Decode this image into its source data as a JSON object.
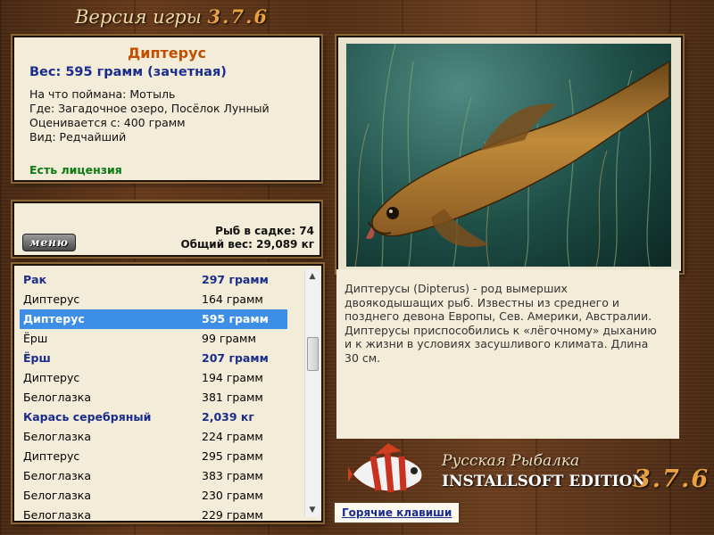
{
  "header": {
    "version_prefix": "Версия игры",
    "version_number": "3.7.6"
  },
  "info": {
    "fish_name": "Диптерус",
    "weight": "Вес: 595 грамм (зачетная)",
    "bait": "На что поймана: Мотыль",
    "place": "Где: Загадочное озеро, Посёлок Лунный",
    "rated": "Оценивается с: 400 грамм",
    "kind": "Вид: Редчайший",
    "license": "Есть лицензия"
  },
  "stats": {
    "menu_label": "меню",
    "fish_in_keepnet": "Рыб в садке: 74",
    "total_weight": "Общий вес: 29,089 кг"
  },
  "catch_list": [
    {
      "name": "Рак",
      "weight": "297 грамм",
      "style": "bold"
    },
    {
      "name": "Диптерус",
      "weight": "164 грамм",
      "style": "normal"
    },
    {
      "name": "Диптерус",
      "weight": "595 грамм",
      "style": "selected"
    },
    {
      "name": "Ёрш",
      "weight": "99 грамм",
      "style": "normal"
    },
    {
      "name": "Ёрш",
      "weight": "207 грамм",
      "style": "bold"
    },
    {
      "name": "Диптерус",
      "weight": "194 грамм",
      "style": "normal"
    },
    {
      "name": "Белоглазка",
      "weight": "381 грамм",
      "style": "normal"
    },
    {
      "name": "Карась серебряный",
      "weight": "2,039 кг",
      "style": "bold"
    },
    {
      "name": "Белоглазка",
      "weight": "224 грамм",
      "style": "normal"
    },
    {
      "name": "Диптерус",
      "weight": "295 грамм",
      "style": "normal"
    },
    {
      "name": "Белоглазка",
      "weight": "383 грамм",
      "style": "normal"
    },
    {
      "name": "Белоглазка",
      "weight": "230 грамм",
      "style": "normal"
    },
    {
      "name": "Белоглазка",
      "weight": "229 грамм",
      "style": "normal"
    }
  ],
  "description": "Диптерусы (Dipterus) - род вымерших двоякодышащих рыб. Известны из среднего и позднего девона Европы, Сев. Америки, Австралии. Диптерусы приспособились к «лёгочному» дыханию и к жизни в условиях засушливого климата. Длина 30 см.",
  "branding": {
    "title_ru": "Русская Рыбалка",
    "edition": "INSTALLSOFT EDITION",
    "version": "3.7.6"
  },
  "hotkeys_label": "Горячие клавиши",
  "icons": {
    "scroll_up": "triangle-up-icon",
    "scroll_down": "triangle-down-icon",
    "logo": "perch-fish-icon"
  },
  "colors": {
    "selected_row": "#3d8ee6",
    "bold_row": "#1a2d8c",
    "fish_title": "#c24f00",
    "license": "#0b7a12"
  }
}
